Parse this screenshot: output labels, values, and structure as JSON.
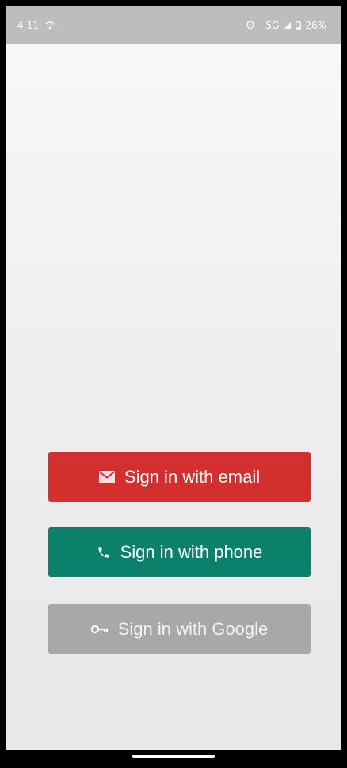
{
  "status_bar": {
    "time": "4:11",
    "network": "5G",
    "battery": "26%",
    "icons": [
      "wifi-icon",
      "location-icon",
      "signal-icon",
      "battery-icon"
    ]
  },
  "buttons": {
    "email": {
      "label": "Sign in with email",
      "icon": "email-icon",
      "color": "#d32f2f"
    },
    "phone": {
      "label": "Sign in with phone",
      "icon": "phone-icon",
      "color": "#0b806b"
    },
    "google": {
      "label": "Sign in with Google",
      "icon": "key-icon",
      "color": "#a8a8a8"
    }
  },
  "colors": {
    "status_bar": "#bdbdbd",
    "background": "#f2f2f2"
  }
}
